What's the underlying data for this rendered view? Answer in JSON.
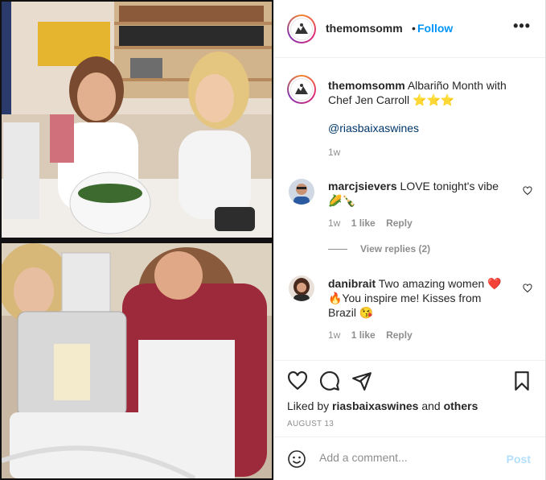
{
  "post": {
    "username": "themomsomm",
    "follow_label": "Follow",
    "dot": "•",
    "more_label": "•••",
    "caption_text": "Albariño Month with Chef Jen Carroll ⭐⭐⭐",
    "mention": "@riasbaixaswines",
    "time": "1w"
  },
  "comments": [
    {
      "username": "marcjsievers",
      "text": "LOVE tonight's vibe 🌽🍾",
      "time": "1w",
      "likes": "1 like",
      "reply_label": "Reply"
    },
    {
      "username": "danibrait",
      "text": "Two amazing women ❤️🔥You inspire me! Kisses from Brazil 😘",
      "time": "1w",
      "likes": "1 like",
      "reply_label": "Reply"
    }
  ],
  "view_replies": "View replies (2)",
  "liked_by": {
    "prefix": "Liked by ",
    "user": "riasbaixaswines",
    "middle": " and ",
    "others": "others"
  },
  "date": "AUGUST 13",
  "add_comment": {
    "placeholder": "Add a comment...",
    "post_label": "Post"
  },
  "icons": {
    "heart": "heart-icon",
    "comment": "comment-icon",
    "share": "paper-plane-icon",
    "save": "bookmark-icon",
    "emoji": "smiley-icon"
  },
  "colors": {
    "accent": "#0095f6",
    "post_disabled": "#b2dffc",
    "muted": "#8e8e8e"
  }
}
